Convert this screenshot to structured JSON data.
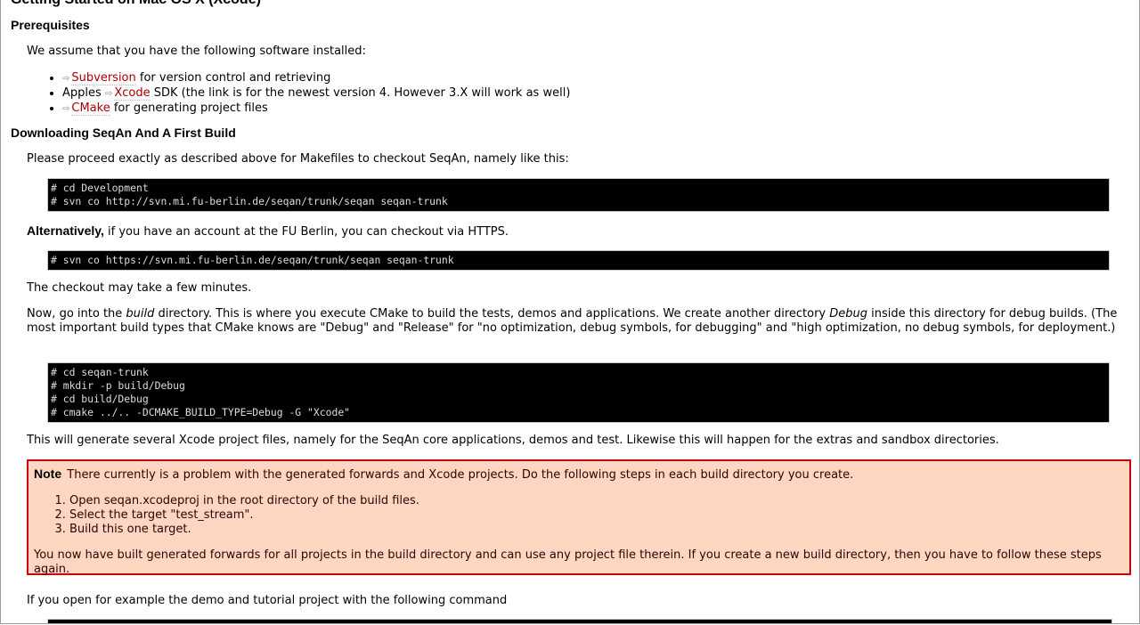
{
  "section_heading": "Getting Started on Mac OS X (Xcode)",
  "prereq": {
    "heading": "Prerequisites",
    "intro": "We assume that you have the following software installed:",
    "items": [
      {
        "prefix": "",
        "link": "Subversion",
        "suffix": " for version control and retrieving"
      },
      {
        "prefix": "Apples ",
        "link": "Xcode",
        "suffix": " SDK (the link is for the newest version 4. However 3.X will work as well)"
      },
      {
        "prefix": "",
        "link": "CMake",
        "suffix": " for generating project files"
      }
    ],
    "ext_icon": "external-link-icon",
    "ext_glyph": "⇨"
  },
  "download": {
    "heading": "Downloading SeqAn And A First Build",
    "intro": "Please proceed exactly as described above for Makefiles to checkout SeqAn, namely like this:",
    "code1": [
      "# cd Development",
      "# svn co http://svn.mi.fu-berlin.de/seqan/trunk/seqan seqan-trunk"
    ],
    "alt_bold": "Alternatively,",
    "alt_rest": " if you have an account at the FU Berlin, you can checkout via HTTPS.",
    "code2": [
      "# svn co https://svn.mi.fu-berlin.de/seqan/trunk/seqan seqan-trunk"
    ],
    "checkout_note": "The checkout may take a few minutes.",
    "build_para": {
      "part1": "Now, go into the ",
      "em1": "build",
      "part2": " directory. This is where you execute CMake to build the tests, demos and applications. We create another directory ",
      "em2": "Debug",
      "part3": " inside this directory for debug builds. (The most important build types that CMake knows are \"Debug\" and \"Release\" for \"no optimization, debug symbols, for debugging\" and \"high optimization, no debug symbols, for deployment.)"
    },
    "code3": [
      "# cd seqan-trunk",
      "# mkdir -p build/Debug",
      "# cd build/Debug",
      "# cmake ../.. -DCMAKE_BUILD_TYPE=Debug -G \"Xcode\""
    ],
    "generate_para": "This will generate several Xcode project files, namely for the SeqAn core applications, demos and test. Likewise this will happen for the extras and sandbox directories."
  },
  "note": {
    "title": "Note",
    "text": " There currently is a problem with the generated forwards and Xcode projects. Do the following steps in each build directory you create.",
    "steps": [
      "Open seqan.xcodeproj in the root directory of the build files.",
      "Select the target \"test_stream\".",
      "Build this one target."
    ],
    "footer": "You now have built generated forwards for all projects in the build directory and can use any project file therein. If you create a new build directory, then you have to follow these steps again."
  },
  "open_para": "If you open for example the demo and tutorial project with the following command",
  "colors": {
    "link": "#aa0000",
    "note_bg": "#ffd6c2",
    "note_border": "#cc0011",
    "code_bg": "#000000"
  }
}
